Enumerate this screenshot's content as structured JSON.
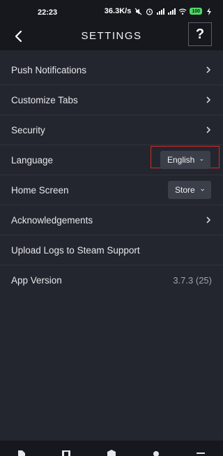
{
  "status_bar": {
    "time": "22:23",
    "speed": "36.3K/s",
    "battery": "100"
  },
  "header": {
    "title": "SETTINGS",
    "help_label": "?"
  },
  "settings": {
    "push_notifications": "Push Notifications",
    "customize_tabs": "Customize Tabs",
    "security": "Security",
    "language": {
      "label": "Language",
      "value": "English"
    },
    "home_screen": {
      "label": "Home Screen",
      "value": "Store"
    },
    "acknowledgements": "Acknowledgements",
    "upload_logs": "Upload Logs to Steam Support",
    "app_version": {
      "label": "App Version",
      "value": "3.7.3 (25)"
    }
  },
  "icons": {
    "back": "chevron-left-icon",
    "chevron": "chevron-right-icon",
    "dropdown": "chevron-down-icon"
  },
  "colors": {
    "background": "#23262e",
    "header": "#16181d",
    "dropdown_bg": "#3b3f49",
    "highlight": "#d12b2b",
    "battery": "#4cd964"
  }
}
